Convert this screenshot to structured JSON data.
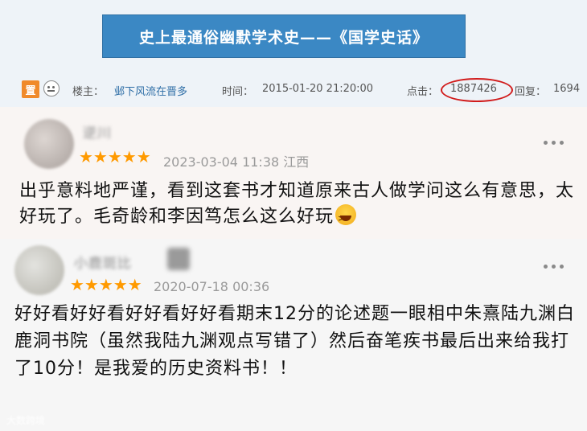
{
  "forum": {
    "title": "史上最通俗幽默学术史——《国学史话》",
    "badge": "置",
    "poster_label": "楼主：",
    "poster_name": "邺下风流在晋多",
    "time_label": "时间：",
    "time_value": "2015-01-20 21:20:00",
    "views_label": "点击：",
    "views_value": "1887426",
    "replies_label": "回复：",
    "replies_value": "1694",
    "highlight_color": "#d11b1b"
  },
  "comments": [
    {
      "username": "逆川",
      "stars": "★★★★★",
      "datetime": "2023-03-04 11:38 江西",
      "text": "出乎意料地严谨，看到这套书才知道原来古人做学问这么有意思，太好玩了。毛奇龄和李因笃怎么这么好玩",
      "emoji": "laughing-emoji"
    },
    {
      "username": "小鹿斑比",
      "stars": "★★★★★",
      "datetime": "2020-07-18 00:36",
      "text": "好好看好好看好好看好好看期末12分的论述题一眼相中朱熹陆九渊白鹿洞书院（虽然我陆九渊观点写错了）然后奋笔疾书最后出来给我打了10分！是我爱的历史资料书！！"
    }
  ],
  "watermark": "大数跨境",
  "star_color": "#ff9a00",
  "icons": [
    "face-icon",
    "more-icon",
    "laughing-emoji-icon"
  ]
}
